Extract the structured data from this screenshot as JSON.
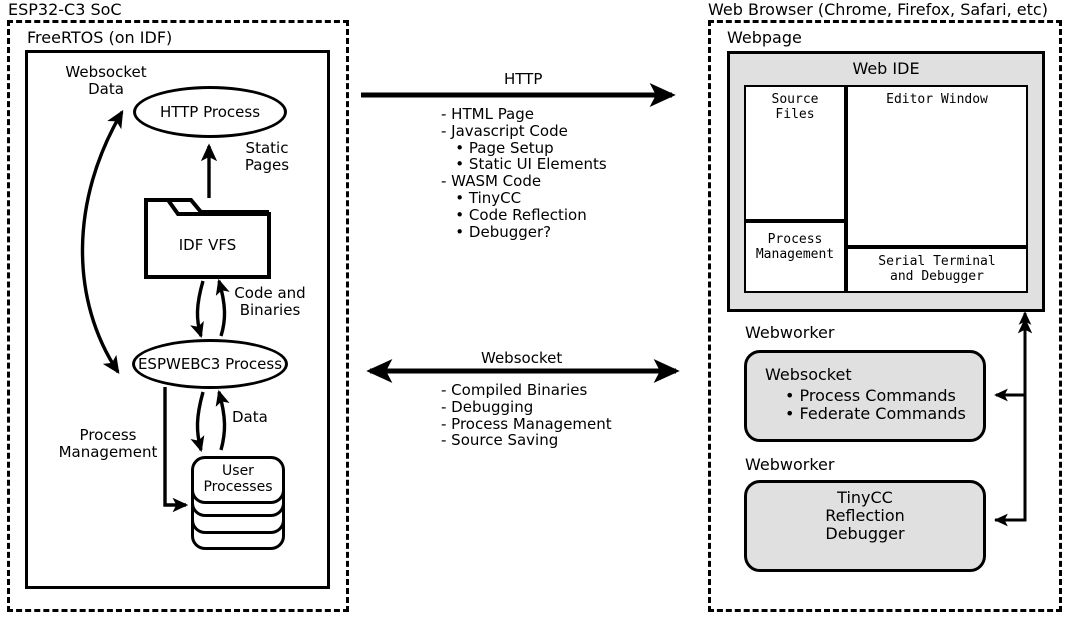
{
  "left_panel": {
    "title": "ESP32-C3 SoC",
    "inner_title": "FreeRTOS (on IDF)",
    "websocket_data_label": "Websocket\nData",
    "http_process": "HTTP\nProcess",
    "static_pages_label": "Static\nPages",
    "vfs_label": "IDF VFS",
    "code_and_binaries_label": "Code and\nBinaries",
    "espwebc3_process": "ESPWEBC3\nProcess",
    "data_label": "Data",
    "process_management_label": "Process\nManagement",
    "user_processes": "User\nProcesses"
  },
  "http_channel": {
    "title": "HTTP",
    "items": [
      "- HTML Page",
      "- Javascript Code",
      "   • Page Setup",
      "   • Static UI Elements",
      "- WASM Code",
      "   • TinyCC",
      "   • Code Reflection",
      "   • Debugger?"
    ]
  },
  "websocket_channel": {
    "title": "Websocket",
    "items": [
      "- Compiled Binaries",
      "- Debugging",
      "- Process Management",
      "- Source Saving"
    ]
  },
  "right_panel": {
    "title": "Web Browser (Chrome, Firefox, Safari, etc)",
    "webpage_label": "Webpage",
    "web_ide": {
      "title": "Web IDE",
      "source_files": "Source\nFiles",
      "editor_window": "Editor Window",
      "process_management": "Process\nManagement",
      "serial_terminal": "Serial Terminal\nand Debugger"
    },
    "worker_one": {
      "label": "Webworker",
      "title": "Websocket",
      "items": [
        "• Process Commands",
        "• Federate Commands"
      ]
    },
    "worker_two": {
      "label": "Webworker",
      "lines": [
        "TinyCC",
        "Reflection",
        "Debugger"
      ]
    }
  },
  "colors": {
    "stroke": "#000000",
    "panel_fill": "#e0e0e0",
    "background": "#ffffff"
  }
}
